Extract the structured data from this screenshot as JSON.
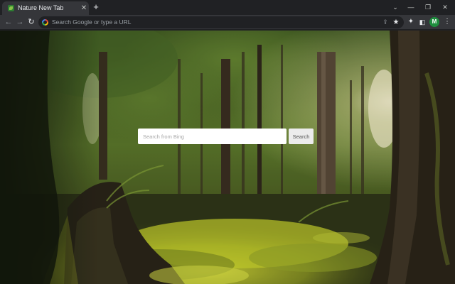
{
  "browser": {
    "tab": {
      "title": "Nature New Tab",
      "favicon": "leaf-icon",
      "close_glyph": "✕"
    },
    "new_tab_glyph": "+",
    "window_controls": {
      "tab_search": "⌄",
      "minimize": "—",
      "restore": "❐",
      "close": "✕"
    },
    "toolbar": {
      "back": "←",
      "forward": "→",
      "reload": "↻",
      "omnibox_placeholder": "Search Google or type a URL",
      "share": "⇪",
      "bookmark": "★",
      "extensions": "✦",
      "side_panel": "◧",
      "avatar_initial": "M",
      "menu": "⋮"
    }
  },
  "newtab": {
    "search_placeholder": "Search from Bing",
    "search_button": "Search",
    "background": "forest-photo"
  },
  "colors": {
    "tabstrip_bg": "#202124",
    "toolbar_bg": "#35363a",
    "avatar_bg": "#1e8e3e",
    "forest_dark": "#1b2414",
    "moss": "#c9d62a",
    "sunlight": "#f4efc8"
  }
}
